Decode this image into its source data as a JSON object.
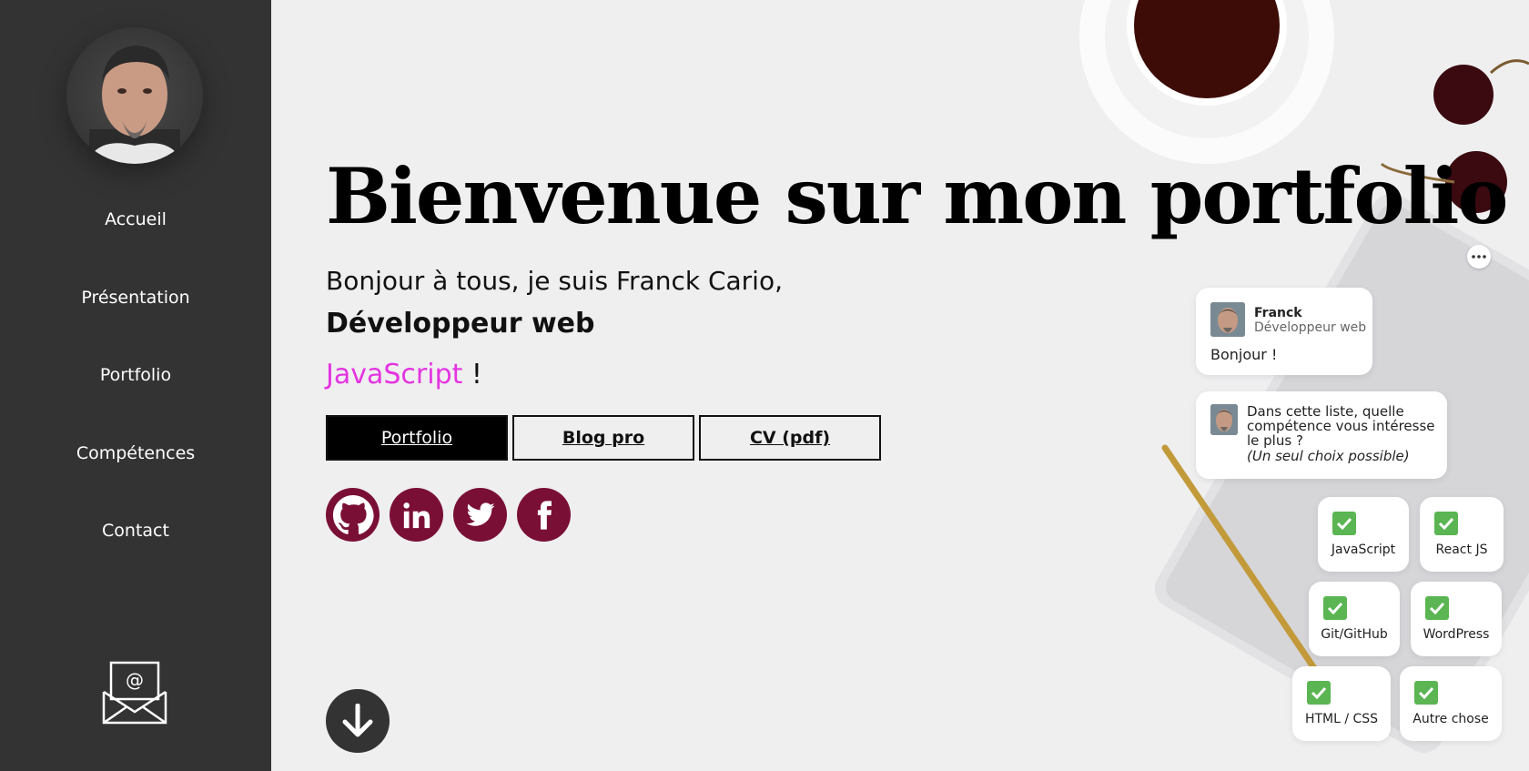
{
  "sidebar": {
    "nav": [
      "Accueil",
      "Présentation",
      "Portfolio",
      "Compétences",
      "Contact"
    ]
  },
  "hero": {
    "title": "Bienvenue sur mon portfolio",
    "greeting": "Bonjour à tous, je suis Franck Cario,",
    "role": "Développeur web",
    "typed_skill": "JavaScript",
    "typed_suffix": " !"
  },
  "buttons": [
    "Portfolio",
    "Blog pro",
    "CV (pdf)"
  ],
  "social": [
    "github-icon",
    "linkedin-icon",
    "twitter-icon",
    "facebook-icon"
  ],
  "chat": {
    "bot_name": "Franck",
    "bot_role": "Développeur web",
    "message1": "Bonjour !",
    "message2": "Dans cette liste, quelle compétence vous intéresse le plus ?",
    "message2_note": "(Un seul choix possible)",
    "choices": [
      "JavaScript",
      "React JS",
      "Git/GitHub",
      "WordPress",
      "HTML / CSS",
      "Autre chose"
    ]
  },
  "colors": {
    "sidebar_bg": "#333333",
    "accent_typed": "#e434e0",
    "social_bg": "#7a0f36",
    "check_green": "#5ab552"
  }
}
